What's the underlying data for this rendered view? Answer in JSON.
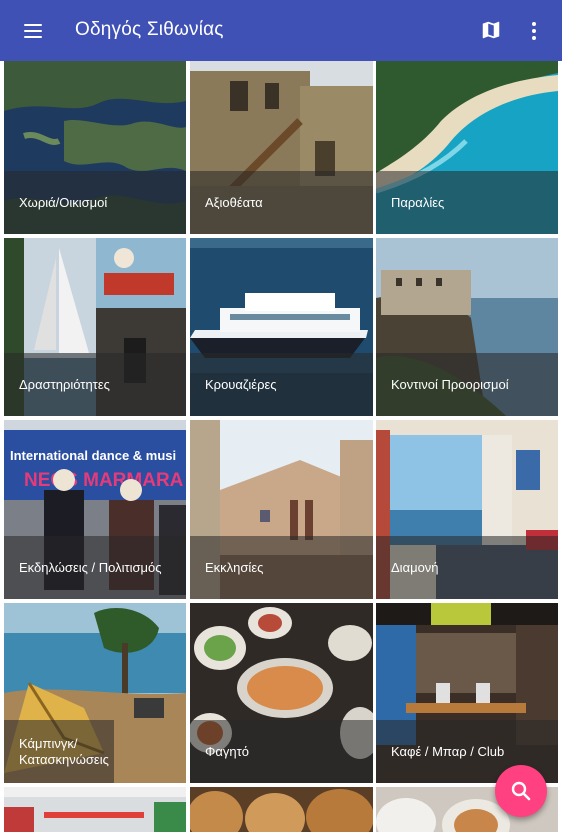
{
  "appbar": {
    "title": "Οδηγός Σιθωνίας",
    "menu_icon": "hamburger-menu-icon",
    "map_icon": "map-icon",
    "more_icon": "more-vert-icon",
    "color": "#3f51b5"
  },
  "categories": [
    {
      "label": "Χωριά/Οικισμοί"
    },
    {
      "label": "Αξιοθέατα"
    },
    {
      "label": "Παραλίες"
    },
    {
      "label": "Δραστηριότητες"
    },
    {
      "label": "Κρουαζιέρες"
    },
    {
      "label": "Κοντινοί Προορισμοί"
    },
    {
      "label": "Εκδηλώσεις / Πολιτισμός"
    },
    {
      "label": "Εκκλησίες"
    },
    {
      "label": "Διαμονή"
    },
    {
      "label": "Κάμπινγκ/ Κατασκηνώσεις"
    },
    {
      "label": "Φαγητό"
    },
    {
      "label": "Καφέ / Μπαρ / Club"
    }
  ],
  "banner_text": {
    "line1": "International dance & musi",
    "line2": "NEOS MARMARA"
  },
  "fab": {
    "icon": "search-icon",
    "color": "#ff4081"
  }
}
